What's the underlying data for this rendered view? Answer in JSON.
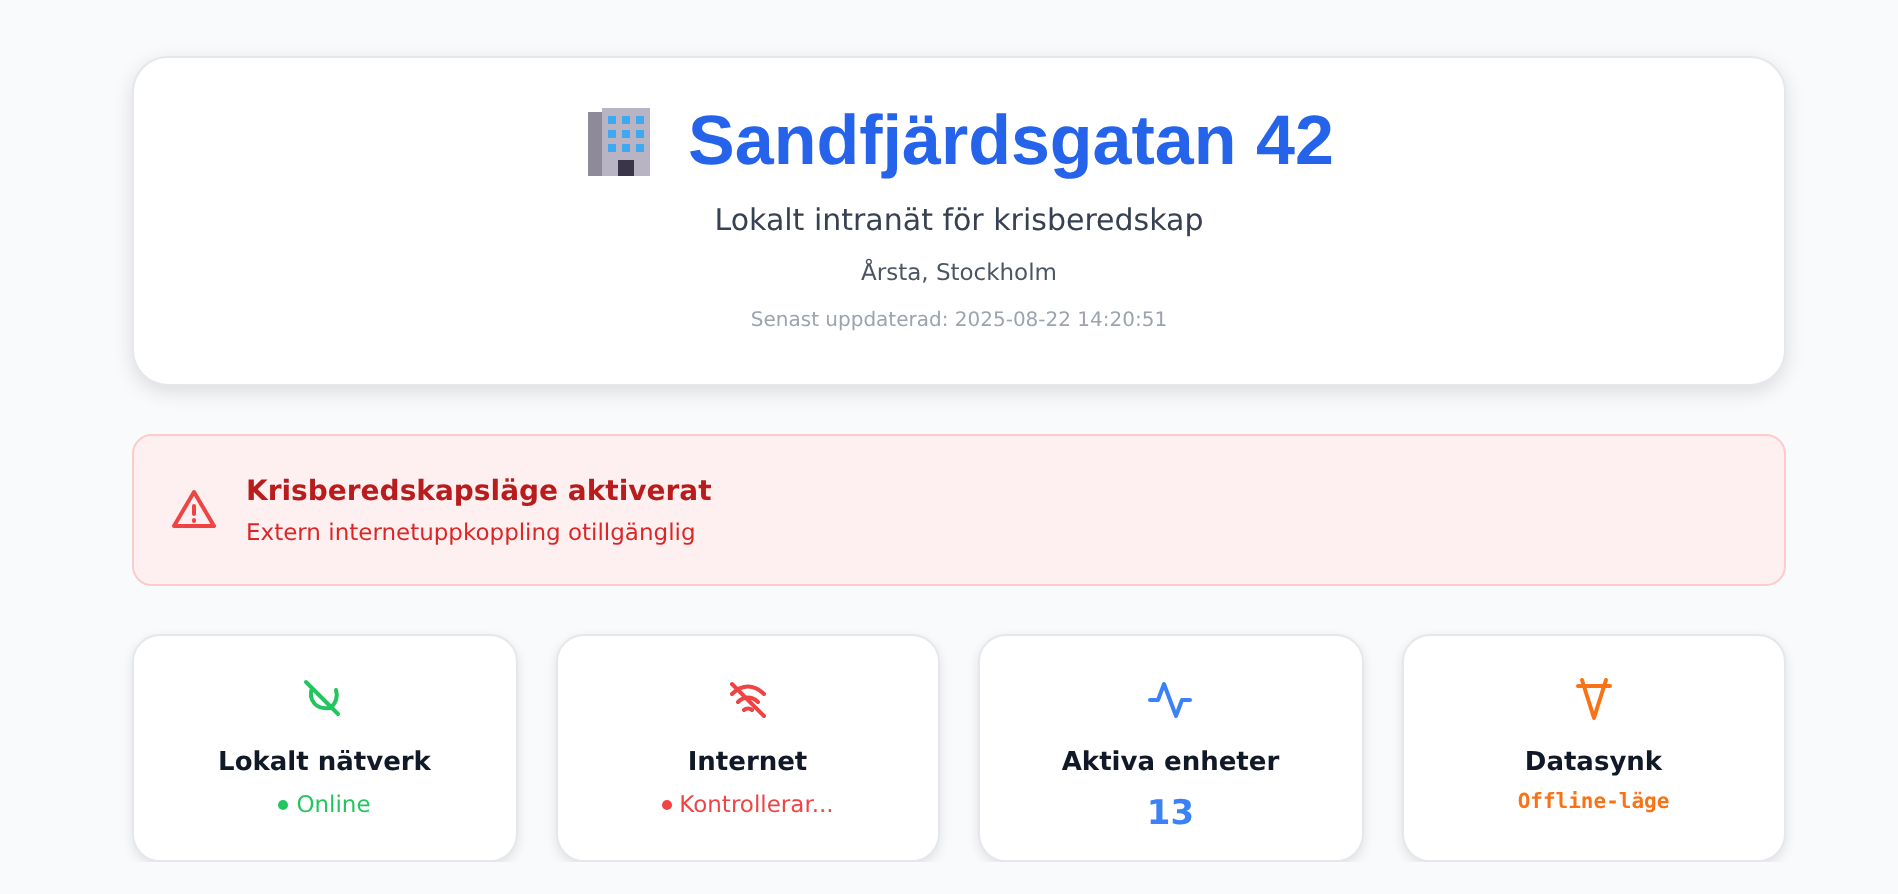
{
  "header": {
    "title": "Sandfjärdsgatan 42",
    "subtitle": "Lokalt intranät för krisberedskap",
    "location": "Årsta, Stockholm",
    "updated": "Senast uppdaterad: 2025-08-22 14:20:51"
  },
  "alert": {
    "title": "Krisberedskapsläge aktiverat",
    "message": "Extern internetuppkoppling otillgänglig"
  },
  "cards": [
    {
      "label": "Lokalt nätverk",
      "kind": "status",
      "value": "Online",
      "color": "#22c55e"
    },
    {
      "label": "Internet",
      "kind": "status",
      "value": "Kontrollerar...",
      "color": "#ef4444"
    },
    {
      "label": "Aktiva enheter",
      "kind": "count",
      "value": "13",
      "color": "#3b82f6"
    },
    {
      "label": "Datasynk",
      "kind": "code",
      "value": "Offline-läge",
      "color": "#f97316"
    }
  ]
}
